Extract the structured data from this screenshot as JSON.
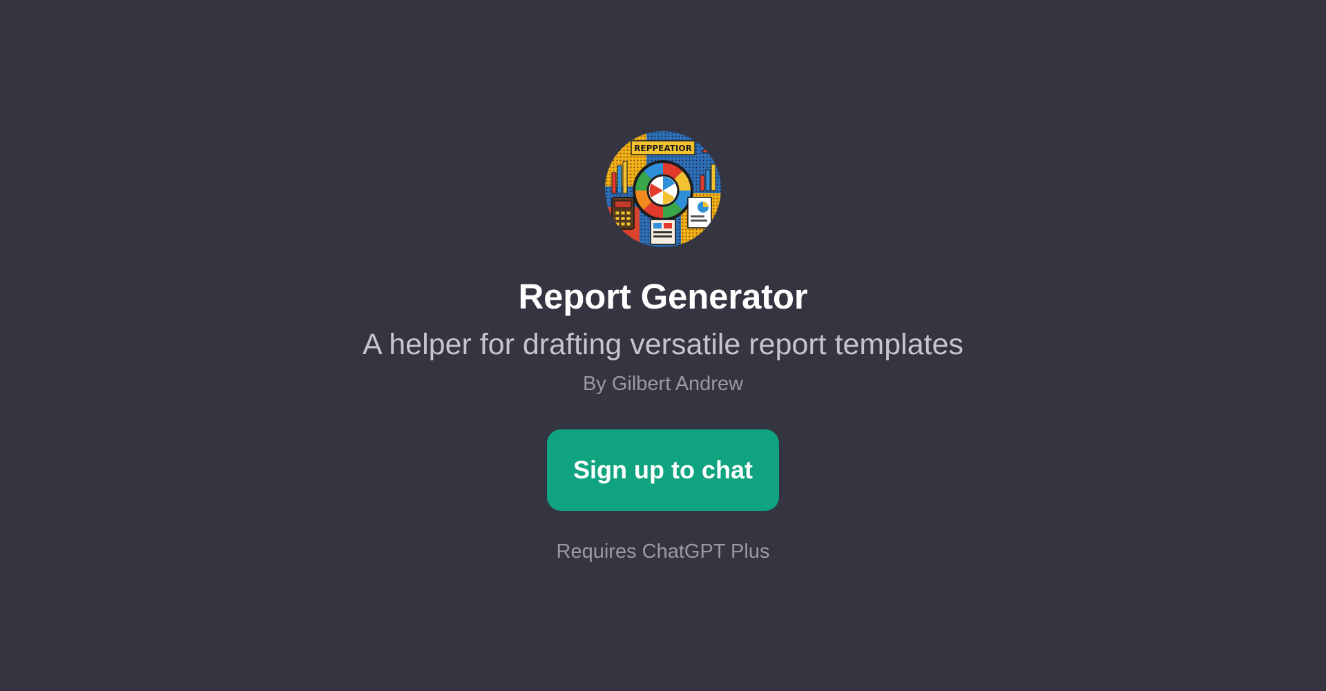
{
  "gpt": {
    "avatar_icon": "report-generator-avatar-icon",
    "avatar_text": "REPPEATIOR",
    "title": "Report Generator",
    "description": "A helper for drafting versatile report templates",
    "author": "By Gilbert Andrew"
  },
  "cta": {
    "label": "Sign up to chat",
    "color": "#10a37f"
  },
  "footer": {
    "requirement": "Requires ChatGPT Plus"
  },
  "colors": {
    "background": "#343541",
    "title": "#ffffff",
    "subtitle": "#c5c5d2",
    "muted": "#9a9aa6"
  }
}
